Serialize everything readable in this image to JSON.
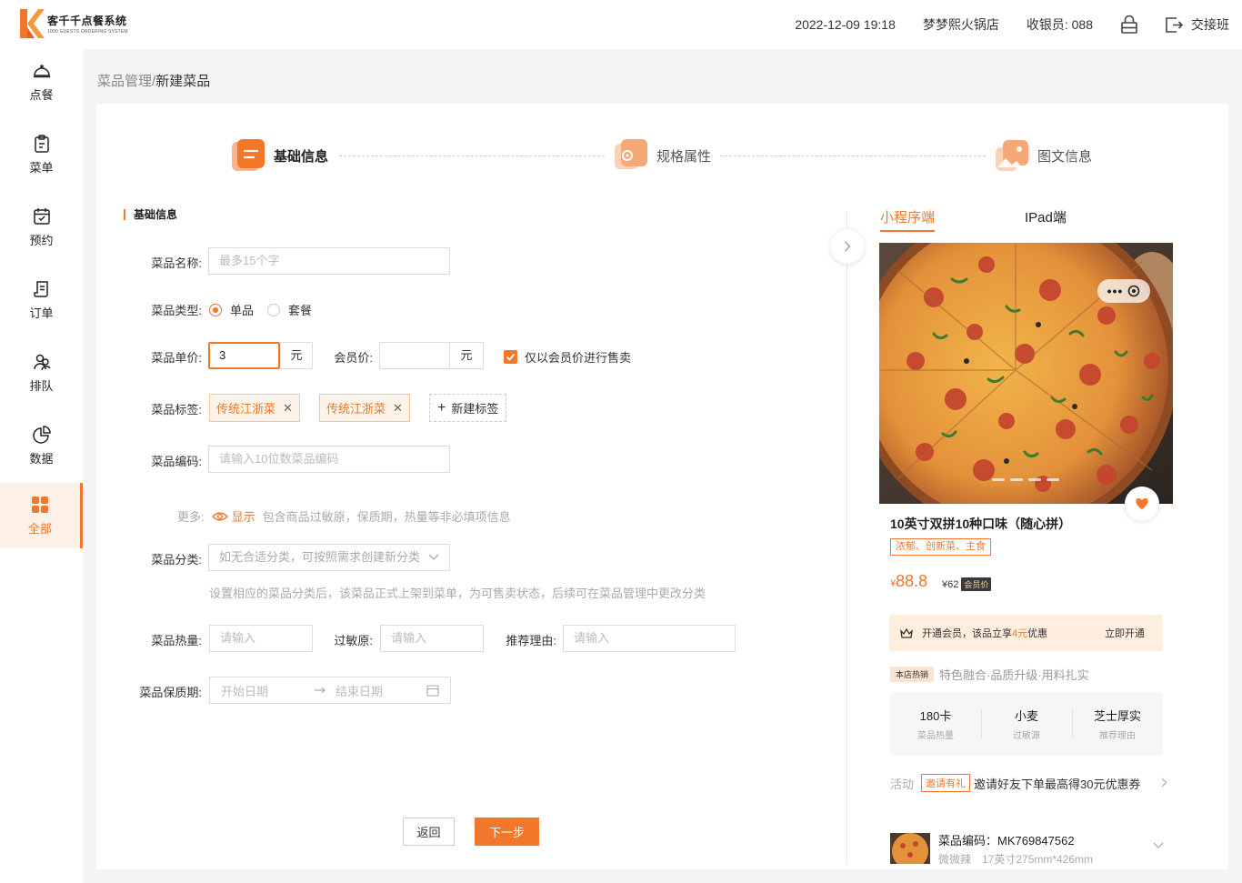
{
  "header": {
    "logo_cn": "客千千点餐系统",
    "logo_en": "1000 GUESTS ORDERING SYSTEM",
    "datetime": "2022-12-09 19:18",
    "store": "梦梦熙火锅店",
    "cashier": "收银员: 088",
    "logout_label": "交接班",
    "brand_color": "#f2772a"
  },
  "sidebar": {
    "items": [
      {
        "label": "点餐",
        "icon": "bell-icon"
      },
      {
        "label": "菜单",
        "icon": "clipboard-icon"
      },
      {
        "label": "预约",
        "icon": "calendar-icon"
      },
      {
        "label": "订单",
        "icon": "receipt-icon"
      },
      {
        "label": "排队",
        "icon": "queue-icon"
      },
      {
        "label": "数据",
        "icon": "pie-chart-icon"
      },
      {
        "label": "全部",
        "icon": "grid-icon",
        "active": true
      }
    ]
  },
  "breadcrumb": {
    "parent": "菜品管理",
    "sep": "/",
    "current": "新建菜品"
  },
  "steps": [
    {
      "label": "基础信息",
      "active": true
    },
    {
      "label": "规格属性",
      "active": false
    },
    {
      "label": "图文信息",
      "active": false
    }
  ],
  "form": {
    "section_title": "基础信息",
    "name": {
      "label": "菜品名称:",
      "placeholder": "最多15个字"
    },
    "type": {
      "label": "菜品类型:",
      "options": [
        "单品",
        "套餐"
      ],
      "selected": "单品"
    },
    "price": {
      "label": "菜品单价:",
      "value": "3",
      "unit": "元"
    },
    "member_price": {
      "label": "会员价:",
      "value": "",
      "unit": "元"
    },
    "member_only": {
      "label": "仅以会员价进行售卖",
      "checked": true
    },
    "tags": {
      "label": "菜品标签:",
      "items": [
        "传统江浙菜",
        "传统江浙菜"
      ],
      "new_label": "新建标签"
    },
    "code": {
      "label": "菜品编码:",
      "placeholder": "请输入10位数菜品编码"
    },
    "more": {
      "label": "更多:",
      "toggle": "显示",
      "desc": "包含商品过敏原，保质期，热量等非必填项信息"
    },
    "category": {
      "label": "菜品分类:",
      "placeholder": "如无合适分类，可按照需求创建新分类",
      "hint": "设置相应的菜品分类后，该菜品正式上架到菜单，为可售卖状态，后续可在菜品管理中更改分类"
    },
    "calories": {
      "label": "菜品热量:",
      "placeholder": "请输入"
    },
    "allergen": {
      "label": "过敏原:",
      "placeholder": "请输入"
    },
    "reason": {
      "label": "推荐理由:",
      "placeholder": "请输入"
    },
    "shelf_life": {
      "label": "菜品保质期:",
      "start": "开始日期",
      "end": "结束日期"
    },
    "back": "返回",
    "next": "下一步"
  },
  "preview": {
    "tabs": [
      "小程序端",
      "IPad端"
    ],
    "active_tab": "小程序端",
    "dish_name": "10英寸双拼10种口味（随心拼）",
    "tags": "浓郁、创新菜、主食",
    "currency": "¥",
    "price": "88.8",
    "member_price": "¥62",
    "member_badge": "会员价",
    "vip": {
      "pre": "开通会员，该品立享",
      "amount": "4元",
      "post": "优惠",
      "action": "立即开通"
    },
    "hot_badge": "本店热销",
    "hot_desc": "特色融合·品质升级·用料扎实",
    "stats": [
      {
        "value": "180卡",
        "key": "菜品热量"
      },
      {
        "value": "小麦",
        "key": "过敏源"
      },
      {
        "value": "芝士厚实",
        "key": "推荐理由"
      }
    ],
    "activity": {
      "label": "活动",
      "badge": "邀请有礼",
      "text": "邀请好友下单最高得30元优惠券"
    },
    "code": {
      "line1": "菜品编码：MK769847562",
      "line2": "微微辣　17英寸275mm*426mm"
    }
  }
}
